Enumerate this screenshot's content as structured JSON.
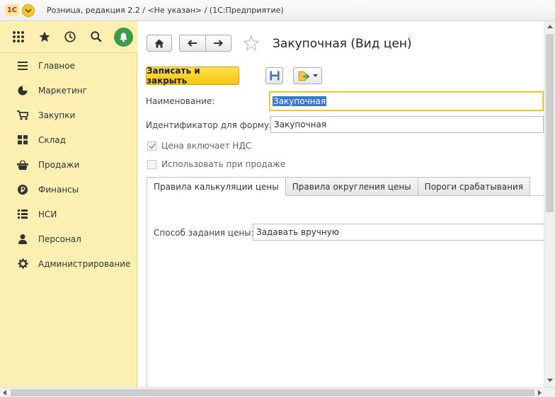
{
  "window": {
    "logo": "1С",
    "title": "Розница, редакция 2.2 / <Не указан> / (1С:Предприятие)"
  },
  "sidebar": {
    "top_icons": [
      "apps-grid-icon",
      "favorites-star-icon",
      "history-icon",
      "search-icon",
      "notifications-bell-icon"
    ],
    "items": [
      {
        "label": "Главное",
        "icon": "menu-lines-icon"
      },
      {
        "label": "Маркетинг",
        "icon": "pie-chart-icon"
      },
      {
        "label": "Закупки",
        "icon": "cart-icon"
      },
      {
        "label": "Склад",
        "icon": "warehouse-icon"
      },
      {
        "label": "Продажи",
        "icon": "basket-icon"
      },
      {
        "label": "Финансы",
        "icon": "ruble-icon"
      },
      {
        "label": "НСИ",
        "icon": "list-icon"
      },
      {
        "label": "Персонал",
        "icon": "person-icon"
      },
      {
        "label": "Администрирование",
        "icon": "gear-icon"
      }
    ]
  },
  "form": {
    "title": "Закупочная (Вид цен)",
    "save_close_label": "Записать и закрыть",
    "name_label": "Наименование:",
    "name_value": "Закупочная",
    "id_label": "Идентификатор для формул:",
    "id_value": "Закупочная",
    "vat_label": "Цена включает НДС",
    "vat_checked": true,
    "sale_label": "Использовать при продаже",
    "sale_checked": false,
    "tabs": [
      "Правила калькуляции цены",
      "Правила округления цены",
      "Пороги срабатывания"
    ],
    "active_tab": 0,
    "price_method_label": "Способ задания цены:",
    "price_method_value": "Задавать вручную"
  },
  "colors": {
    "sidebar_bg": "#fbf0b1",
    "accent_yellow": "#f4c50b",
    "bell_green": "#3e9b4c",
    "selection_blue": "#3a77cf"
  }
}
